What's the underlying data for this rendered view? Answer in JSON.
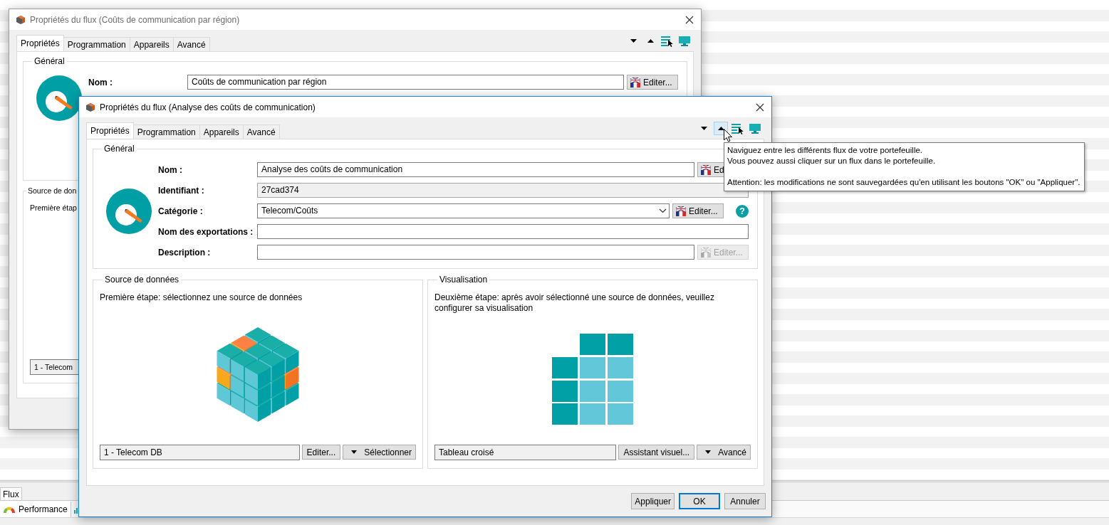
{
  "background_app": {
    "tabs": [
      {
        "label": "Flux",
        "selected": true
      }
    ],
    "panels": [
      {
        "kind": "gauge",
        "label": "Performance"
      },
      {
        "kind": "chart"
      }
    ]
  },
  "back_window": {
    "title": "Propriétés du flux (Coûts de communication par région)",
    "active": false,
    "tabs": [
      {
        "label": "Propriétés",
        "selected": true
      },
      {
        "label": "Programmation",
        "selected": false
      },
      {
        "label": "Appareils",
        "selected": false
      },
      {
        "label": "Avancé",
        "selected": false
      }
    ],
    "toolbar": [
      {
        "kind": "down",
        "hovered": false
      },
      {
        "kind": "up",
        "hovered": false
      },
      {
        "kind": "list",
        "hovered": false
      },
      {
        "kind": "monitor",
        "hovered": false
      }
    ],
    "general": {
      "title": "Général",
      "fields": [
        {
          "kind": "text",
          "label": "Nom :",
          "value": "Coûts de communication par région",
          "button": {
            "kind": "translate",
            "label": "Editer...",
            "disabled": false
          }
        }
      ]
    },
    "groups": [
      {
        "title": "Source de don",
        "hint": "Première étap",
        "value": "1 - Telecom"
      }
    ]
  },
  "front_window": {
    "title": "Propriétés du flux (Analyse des coûts de communication)",
    "active": true,
    "tabs": [
      {
        "label": "Propriétés",
        "selected": true
      },
      {
        "label": "Programmation",
        "selected": false
      },
      {
        "label": "Appareils",
        "selected": false
      },
      {
        "label": "Avancé",
        "selected": false
      }
    ],
    "toolbar": [
      {
        "kind": "down",
        "hovered": false
      },
      {
        "kind": "up",
        "hovered": true
      },
      {
        "kind": "list",
        "hovered": false
      },
      {
        "kind": "monitor",
        "hovered": false
      }
    ],
    "general": {
      "title": "Général",
      "fields": [
        {
          "kind": "text",
          "label": "Nom :",
          "value": "Analyse des coûts de communication",
          "button": {
            "kind": "translate",
            "label": "Ed",
            "disabled": false
          }
        },
        {
          "kind": "readonly",
          "label": "Identifiant :",
          "value": "27cad374"
        },
        {
          "kind": "dropdown",
          "label": "Catégorie :",
          "value": "Telecom/Coûts",
          "button": {
            "kind": "translate",
            "label": "Editer...",
            "disabled": false
          },
          "help": "?"
        },
        {
          "kind": "text",
          "label": "Nom des exportations :"
        },
        {
          "kind": "text",
          "label": "Description :",
          "button": {
            "kind": "translate",
            "label": "Editer...",
            "disabled": true
          }
        }
      ]
    },
    "groups": [
      {
        "kind": "cubes",
        "title": "Source de données",
        "hint": "Première étape: sélectionnez une source de données",
        "value": "1 - Telecom DB",
        "buttons": [
          {
            "kind": "plain",
            "label": "Editer..."
          },
          {
            "kind": "menu",
            "label": "Sélectionner"
          }
        ]
      },
      {
        "kind": "tiles",
        "title": "Visualisation",
        "hint": "Deuxième étape: après avoir sélectionné une source de données, veuillez configurer sa visualisation",
        "value": "Tableau croisé",
        "buttons": [
          {
            "kind": "plain",
            "label": "Assistant visuel..."
          },
          {
            "kind": "menu",
            "label": "Avancé"
          }
        ]
      }
    ],
    "footer": [
      {
        "label": "Appliquer",
        "default": false
      },
      {
        "label": "OK",
        "default": true
      },
      {
        "label": "Annuler",
        "default": false
      }
    ]
  },
  "tooltip": {
    "paragraphs": [
      {
        "lines": [
          "Naviguez entre les différents flux de votre portefeuille.",
          "Vous pouvez aussi cliquer sur un flux dans le portefeuille."
        ]
      },
      {
        "lines": [
          "Attention: les modifications ne sont sauvegardées qu'en utilisant les boutons \"OK\" ou \"Appliquer\"."
        ]
      }
    ]
  }
}
